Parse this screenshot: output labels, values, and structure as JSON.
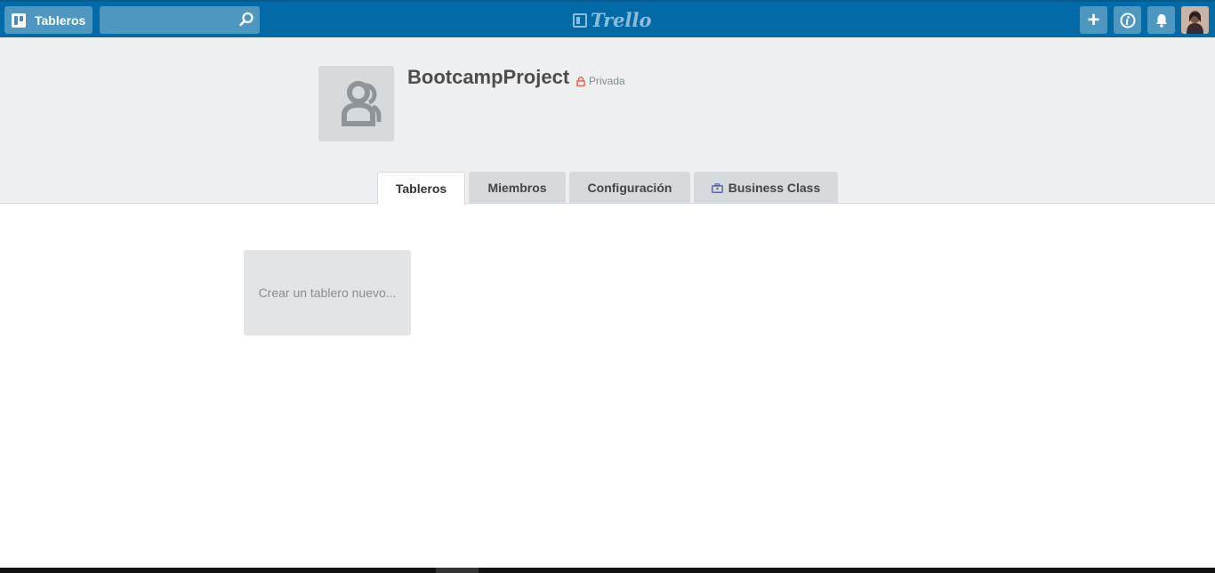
{
  "topbar": {
    "boards_label": "Tableros",
    "search_value": "",
    "search_placeholder": "",
    "logo_text": "Trello",
    "icons": {
      "boards": "boards-icon",
      "search": "search-icon",
      "add": "plus-icon",
      "info": "info-icon",
      "notifications": "bell-icon"
    },
    "add_glyph": "+",
    "brand_color": "#026aa7"
  },
  "team": {
    "name": "BootcampProject",
    "privacy": "Privada",
    "privacy_color": "#eb5a46",
    "avatar_icon": "team-icon"
  },
  "tabs": [
    {
      "label": "Tableros",
      "active": true
    },
    {
      "label": "Miembros",
      "active": false
    },
    {
      "label": "Configuración",
      "active": false
    },
    {
      "label": "Business Class",
      "active": false,
      "icon": "briefcase-icon"
    }
  ],
  "content": {
    "create_board_label": "Crear un tablero nuevo..."
  }
}
